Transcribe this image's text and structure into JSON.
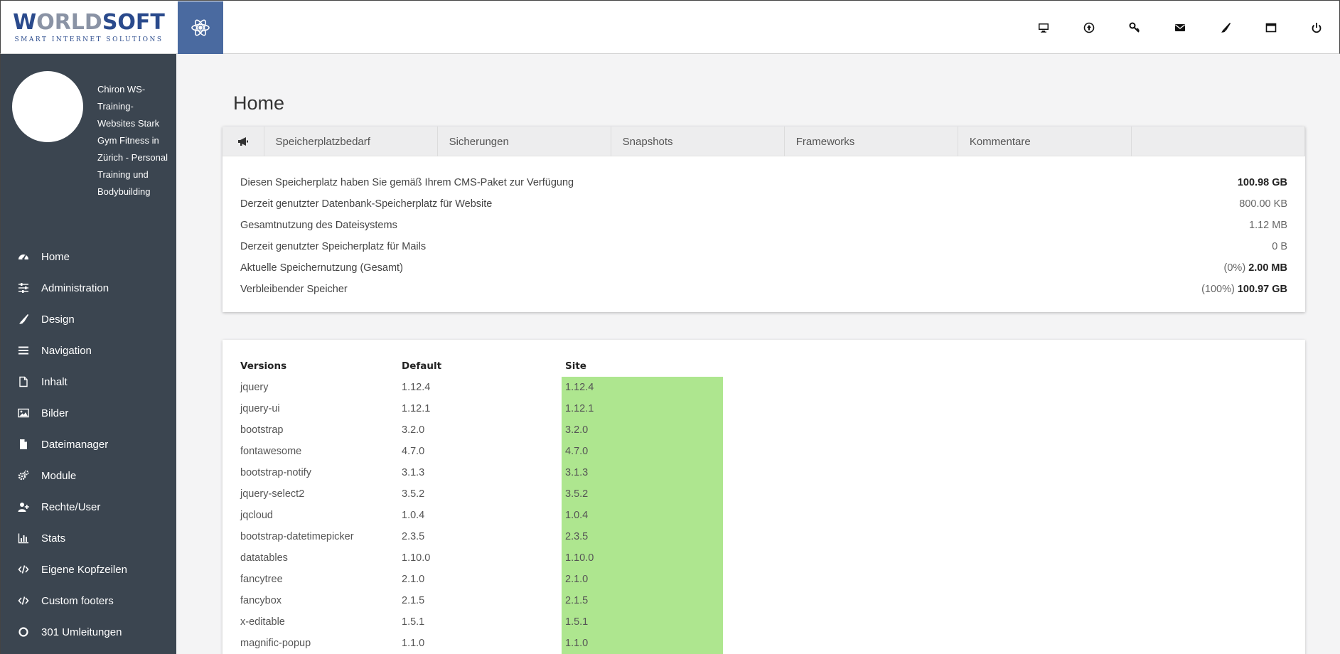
{
  "brand": {
    "logo_main_a": "W",
    "logo_main_b": "ORLD",
    "logo_main_c": "SOFT",
    "logo_sub": "SMART INTERNET SOLUTIONS"
  },
  "topbar": {
    "icons": [
      "desktop-icon",
      "upload-icon",
      "key-icon",
      "envelope-icon",
      "brush-icon",
      "window-icon",
      "power-icon"
    ]
  },
  "sidebar": {
    "site_name": "Chiron WS-Training-Websites Stark Gym Fitness in Zürich - Personal Training und Bodybuilding",
    "items": [
      {
        "label": "Home",
        "icon": "dashboard-icon"
      },
      {
        "label": "Administration",
        "icon": "sliders-icon"
      },
      {
        "label": "Design",
        "icon": "brush-icon"
      },
      {
        "label": "Navigation",
        "icon": "bars-icon"
      },
      {
        "label": "Inhalt",
        "icon": "file-outline-icon"
      },
      {
        "label": "Bilder",
        "icon": "image-icon"
      },
      {
        "label": "Dateimanager",
        "icon": "file-icon"
      },
      {
        "label": "Module",
        "icon": "cogs-icon"
      },
      {
        "label": "Rechte/User",
        "icon": "user-plus-icon"
      },
      {
        "label": "Stats",
        "icon": "bar-chart-icon"
      },
      {
        "label": "Eigene Kopfzeilen",
        "icon": "code-icon"
      },
      {
        "label": "Custom footers",
        "icon": "code-icon"
      },
      {
        "label": "301 Umleitungen",
        "icon": "circle-icon"
      }
    ]
  },
  "main": {
    "title": "Home",
    "tabs": [
      "Speicherplatzbedarf",
      "Sicherungen",
      "Snapshots",
      "Frameworks",
      "Kommentare",
      ""
    ],
    "storage_rows": [
      {
        "label": "Diesen Speicherplatz haben Sie gemäß Ihrem CMS-Paket zur Verfügung",
        "prefix": "",
        "value": "100.98 GB",
        "bold": true
      },
      {
        "label": "Derzeit genutzter Datenbank-Speicherplatz für Website",
        "prefix": "",
        "value": "800.00 KB",
        "bold": false
      },
      {
        "label": "Gesamtnutzung des Dateisystems",
        "prefix": "",
        "value": "1.12 MB",
        "bold": false
      },
      {
        "label": "Derzeit genutzter Speicherplatz für Mails",
        "prefix": "",
        "value": "0 B",
        "bold": false
      },
      {
        "label": "Aktuelle Speichernutzung (Gesamt)",
        "prefix": "(0%) ",
        "value": "2.00 MB",
        "bold": true
      },
      {
        "label": "Verbleibender Speicher",
        "prefix": "(100%) ",
        "value": "100.97 GB",
        "bold": true
      }
    ],
    "versions": {
      "headers": [
        "Versions",
        "Default",
        "Site"
      ],
      "rows": [
        [
          "jquery",
          "1.12.4",
          "1.12.4"
        ],
        [
          "jquery-ui",
          "1.12.1",
          "1.12.1"
        ],
        [
          "bootstrap",
          "3.2.0",
          "3.2.0"
        ],
        [
          "fontawesome",
          "4.7.0",
          "4.7.0"
        ],
        [
          "bootstrap-notify",
          "3.1.3",
          "3.1.3"
        ],
        [
          "jquery-select2",
          "3.5.2",
          "3.5.2"
        ],
        [
          "jqcloud",
          "1.0.4",
          "1.0.4"
        ],
        [
          "bootstrap-datetimepicker",
          "2.3.5",
          "2.3.5"
        ],
        [
          "datatables",
          "1.10.0",
          "1.10.0"
        ],
        [
          "fancytree",
          "2.1.0",
          "2.1.0"
        ],
        [
          "fancybox",
          "2.1.5",
          "2.1.5"
        ],
        [
          "x-editable",
          "1.5.1",
          "1.5.1"
        ],
        [
          "magnific-popup",
          "1.1.0",
          "1.1.0"
        ]
      ],
      "site_match_color": "#aee68f"
    }
  },
  "colors": {
    "sidebar_bg": "#3b4550",
    "accent": "#4a6aa0",
    "logo_blue": "#2a4a8c"
  }
}
